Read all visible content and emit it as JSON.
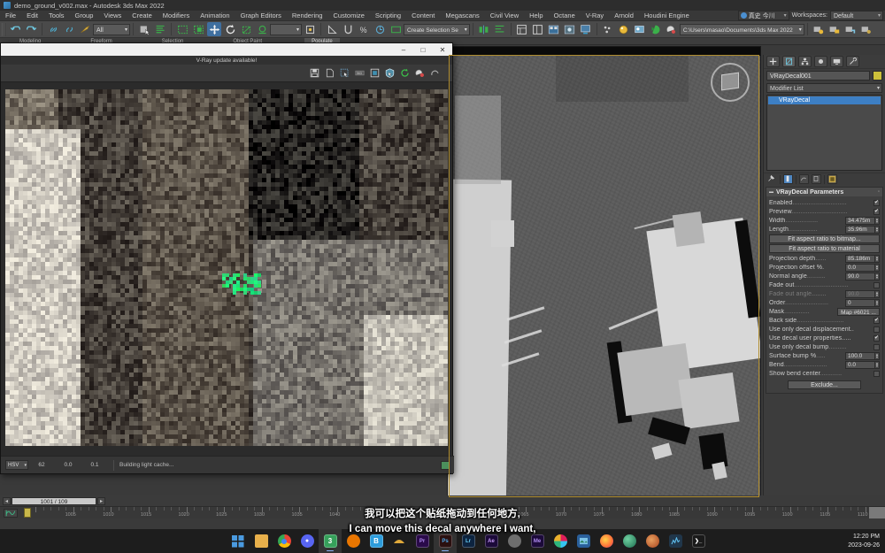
{
  "titlebar": {
    "text": "demo_ground_v002.max - Autodesk 3ds Max 2022",
    "icon": "max-app-icon"
  },
  "menubar": {
    "items": [
      {
        "label": "File"
      },
      {
        "label": "Edit"
      },
      {
        "label": "Tools"
      },
      {
        "label": "Group"
      },
      {
        "label": "Views"
      },
      {
        "label": "Create"
      },
      {
        "label": "Modifiers"
      },
      {
        "label": "Animation"
      },
      {
        "label": "Graph Editors"
      },
      {
        "label": "Rendering"
      },
      {
        "label": "Customize"
      },
      {
        "label": "Scripting"
      },
      {
        "label": "Content"
      },
      {
        "label": "Megascans"
      },
      {
        "label": "Civil View"
      },
      {
        "label": "Help"
      },
      {
        "label": "Octane"
      },
      {
        "label": "V-Ray"
      },
      {
        "label": "Arnold"
      },
      {
        "label": "Houdini Engine"
      }
    ],
    "user": "真史 今川",
    "workspace_label": "Workspaces:",
    "workspace_value": "Default"
  },
  "toolbar": {
    "selection_filter": "All",
    "selection_set": "Create Selection Se",
    "project_path": "C:\\Users\\masao\\Documents\\3ds Max 2022"
  },
  "ribbon": {
    "tabs": [
      {
        "label": "Modeling",
        "active": false
      },
      {
        "label": "Freeform",
        "active": false
      },
      {
        "label": "Selection",
        "active": false
      },
      {
        "label": "Object Paint",
        "active": false
      },
      {
        "label": "Populate",
        "active": true
      }
    ]
  },
  "vfb": {
    "notice": "V-Ray update available!",
    "window_buttons": {
      "minimize": "–",
      "maximize": "□",
      "close": "✕"
    },
    "toolbar_icons": [
      "save-image-icon",
      "save-raw-icon",
      "region-render-icon",
      "resolution-icon",
      "duplicate-buffer-icon",
      "vray-render-icon",
      "refresh-icon",
      "color-pick-icon",
      "stop-icon"
    ],
    "status": {
      "color_mode": "HSV",
      "value_1": "62",
      "value_2": "0.0",
      "value_3": "0.1",
      "message": "Building light cache..."
    }
  },
  "viewport": {
    "label": "",
    "viewcube": "view-cube"
  },
  "command_panel": {
    "tabs": [
      "create-tab",
      "modify-tab",
      "hierarchy-tab",
      "motion-tab",
      "display-tab",
      "utilities-tab"
    ],
    "object_name": "VRayDecal001",
    "modifier_list": "Modifier List",
    "stack": [
      {
        "label": "VRayDecal",
        "selected": true
      }
    ],
    "rollout": {
      "title": "VRayDecal Parameters",
      "params": [
        {
          "type": "check",
          "label": "Enabled",
          "dots": "..............................",
          "value": true
        },
        {
          "type": "check",
          "label": "Preview",
          "dots": "...............................",
          "value": true
        },
        {
          "type": "spin",
          "label": "Width",
          "dots": "..................",
          "value": "34.475m"
        },
        {
          "type": "spin",
          "label": "Length",
          "dots": "................",
          "value": "35.96m"
        },
        {
          "type": "button",
          "label": "Fit aspect ratio to bitmap..."
        },
        {
          "type": "button",
          "label": "Fit aspect ratio to material"
        },
        {
          "type": "spin",
          "label": "Projection depth",
          "dots": "......",
          "value": "85.186m"
        },
        {
          "type": "spin",
          "label": "Projection offset %.",
          "dots": "",
          "value": "0.0"
        },
        {
          "type": "spin",
          "label": "Normal angle",
          "dots": "..........",
          "value": "90.0"
        },
        {
          "type": "check",
          "label": "Fade out",
          "dots": "..............................",
          "value": false
        },
        {
          "type": "spin",
          "label": "Fade out angle",
          "dots": "........",
          "value": "90.0",
          "dim": true
        },
        {
          "type": "spin",
          "label": "Order",
          "dots": "........................",
          "value": "0"
        },
        {
          "type": "map",
          "label": "Mask",
          "dots": "..............",
          "value": "Map #6021 ..."
        },
        {
          "type": "check",
          "label": "Back side",
          "dots": "..........................",
          "value": true
        },
        {
          "type": "check",
          "label": "Use only decal displacement..",
          "dots": "",
          "value": false
        },
        {
          "type": "check",
          "label": "Use decal user properties.....",
          "dots": "",
          "value": true
        },
        {
          "type": "check",
          "label": "Use only decal bump",
          "dots": "..........",
          "value": false
        },
        {
          "type": "spin",
          "label": "Surface bump %",
          "dots": ".....",
          "value": "100.0"
        },
        {
          "type": "spin",
          "label": "Bend",
          "dots": "........................",
          "value": "0.0"
        },
        {
          "type": "check",
          "label": "Show bend center",
          "dots": "............",
          "value": false
        },
        {
          "type": "button",
          "label": "Exclude...",
          "narrow": true
        }
      ]
    }
  },
  "timeline": {
    "frame_field": "1001 / 109",
    "prev_label": "◂",
    "next_label": "▸",
    "tick_labels": [
      "1005",
      "1010",
      "1015",
      "1020",
      "1025",
      "1030",
      "1035",
      "1040",
      "1045",
      "1050",
      "1055",
      "1060",
      "1065",
      "1070",
      "1075",
      "1080",
      "1085",
      "1090",
      "1095",
      "1100",
      "1105",
      "1110"
    ],
    "tick_start": 1005,
    "tick_step": 5
  },
  "subtitles": {
    "chinese": "我可以把这个贴纸拖动到任何地方,",
    "english": "I can move this decal anywhere I want,"
  },
  "taskbar": {
    "apps": [
      {
        "name": "start-button",
        "glyph": "⊞",
        "color": "#2b7cd3",
        "text": ""
      },
      {
        "name": "file-explorer-icon",
        "glyph": "",
        "color": "#e8b04b",
        "text": ""
      },
      {
        "name": "chrome-icon",
        "glyph": "",
        "color": "#f2f2f2",
        "text": ""
      },
      {
        "name": "discord-icon",
        "glyph": "",
        "color": "#5865f2",
        "text": ""
      },
      {
        "name": "3ds-max-icon",
        "glyph": "3",
        "color": "#36a05b",
        "text": "3",
        "running": true
      },
      {
        "name": "blender-icon",
        "glyph": "",
        "color": "#ea7600",
        "text": ""
      },
      {
        "name": "substance-painter-icon",
        "glyph": "B",
        "color": "#2d9cdb",
        "text": "B"
      },
      {
        "name": "marmoset-icon",
        "glyph": "",
        "color": "#e0a93a",
        "text": ""
      },
      {
        "name": "premiere-pro-icon",
        "glyph": "Pr",
        "color": "#2a0a4a",
        "text": "Pr"
      },
      {
        "name": "photoshop-icon",
        "glyph": "Ps",
        "color": "#2a1010",
        "text": "Ps",
        "running": true
      },
      {
        "name": "lightroom-icon",
        "glyph": "Lr",
        "color": "#0d2440",
        "text": "Lr"
      },
      {
        "name": "after-effects-icon",
        "glyph": "Ae",
        "color": "#1c0a3a",
        "text": "Ae"
      },
      {
        "name": "zbrush-icon",
        "glyph": "",
        "color": "#6e6e6e",
        "text": ""
      },
      {
        "name": "mediaencoder-icon",
        "glyph": "Me",
        "color": "#1c0a3a",
        "text": "Me"
      },
      {
        "name": "slack-icon",
        "glyph": "",
        "color": "#ffffff",
        "text": ""
      },
      {
        "name": "designer-icon",
        "glyph": "",
        "color": "#3a7fc4",
        "text": ""
      },
      {
        "name": "firefox-icon",
        "glyph": "",
        "color": "#ff7139",
        "text": ""
      },
      {
        "name": "quixel-bridge-icon",
        "glyph": "",
        "color": "#2e7d5a",
        "text": ""
      },
      {
        "name": "houdini-icon",
        "glyph": "",
        "color": "#c4622d",
        "text": ""
      },
      {
        "name": "task-manager-icon",
        "glyph": "",
        "color": "#2f7fd0",
        "text": ""
      },
      {
        "name": "terminal-icon",
        "glyph": "❯",
        "color": "#1a1a1a",
        "text": "❯_"
      }
    ],
    "clock_time": "12:20 PM",
    "clock_date": "2023-09-26"
  }
}
